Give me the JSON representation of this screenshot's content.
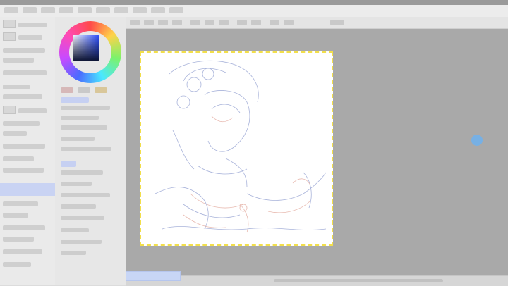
{
  "app": {
    "title": ""
  },
  "menu": {
    "items": [
      "",
      "",
      "",
      "",
      "",
      "",
      "",
      "",
      "",
      ""
    ],
    "zoom_text": ""
  },
  "toolbar": {
    "buttons": 12
  },
  "left_panel": {
    "items": 26
  },
  "color_panel": {
    "wheel_colors": [
      "#ff4a4a",
      "#ffd24a",
      "#7cf26a",
      "#4ae8ff",
      "#4a6bff",
      "#c84aff",
      "#ff4ab4"
    ],
    "selected_color": "#2a4cff"
  },
  "canvas": {
    "background": "#ffffff",
    "selection_border_color": "#f2df4c",
    "line_colors": [
      "#9aa6d4",
      "#e6b3a8"
    ]
  },
  "workspace": {
    "background": "#a9a9a9",
    "note": "",
    "cursor_color": "#6fb2ef"
  }
}
